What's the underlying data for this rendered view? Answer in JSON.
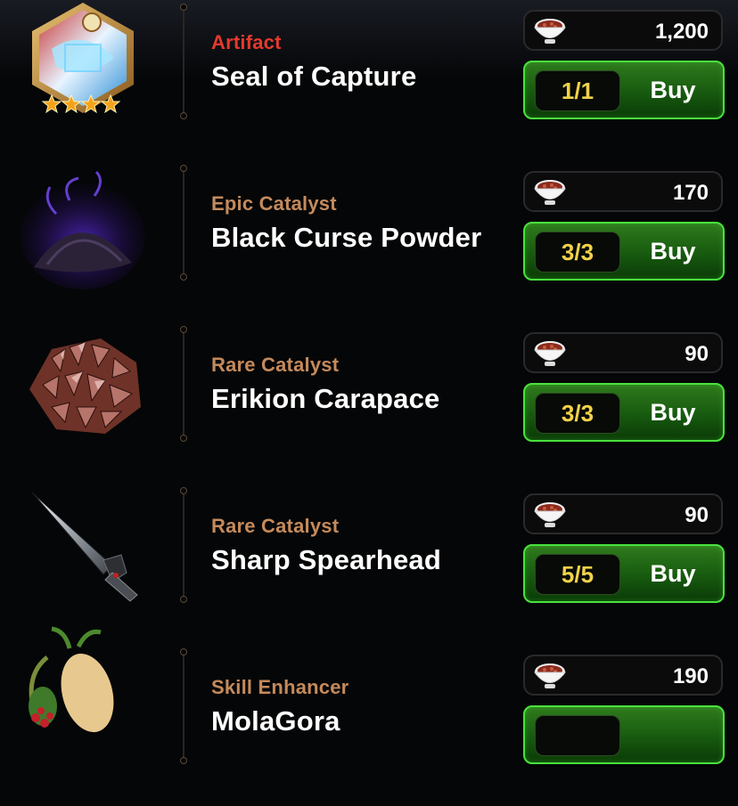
{
  "shop": {
    "items": [
      {
        "category": "Artifact",
        "category_color": "#e5392d",
        "name": "Seal of Capture",
        "price": "1,200",
        "stock": "1/1",
        "buy_label": "Buy",
        "rating_stars": 4,
        "icon": "seal-of-capture-artifact-icon"
      },
      {
        "category": "Epic Catalyst",
        "category_color": "#c48a5c",
        "name": "Black Curse Powder",
        "price": "170",
        "stock": "3/3",
        "buy_label": "Buy",
        "icon": "black-curse-powder-icon"
      },
      {
        "category": "Rare Catalyst",
        "category_color": "#c48a5c",
        "name": "Erikion Carapace",
        "price": "90",
        "stock": "3/3",
        "buy_label": "Buy",
        "icon": "erikion-carapace-icon"
      },
      {
        "category": "Rare Catalyst",
        "category_color": "#c48a5c",
        "name": "Sharp Spearhead",
        "price": "90",
        "stock": "5/5",
        "buy_label": "Buy",
        "icon": "sharp-spearhead-icon"
      },
      {
        "category": "Skill Enhancer",
        "category_color": "#c48a5c",
        "name": "MolaGora",
        "price": "190",
        "stock": "",
        "buy_label": "",
        "icon": "molagora-icon"
      }
    ],
    "currency_icon": "bowl-currency-icon",
    "colors": {
      "buy_border": "#49e23d",
      "buy_fill": "#175a0f",
      "stock_text": "#f0d24a",
      "background": "#050607"
    }
  }
}
